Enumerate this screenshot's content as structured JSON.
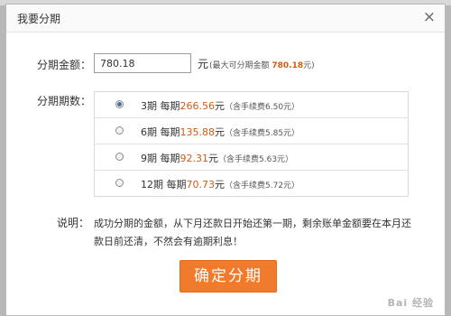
{
  "dialog": {
    "title": "我要分期",
    "close_glyph": "×"
  },
  "amount": {
    "label": "分期金额：",
    "value": "780.18",
    "unit": "元",
    "limit_prefix": "(最大可分期金额",
    "limit_value": "780.18",
    "limit_suffix": "元)"
  },
  "plans": {
    "label": "分期期数：",
    "selected_index": 0,
    "items": [
      {
        "term": "3期 每期",
        "amount": "266.56",
        "unit": "元",
        "fee": "（含手续费6.50元）"
      },
      {
        "term": "6期 每期",
        "amount": "135.88",
        "unit": "元",
        "fee": "（含手续费5.85元）"
      },
      {
        "term": "9期 每期",
        "amount": "92.31",
        "unit": "元",
        "fee": "（含手续费5.63元）"
      },
      {
        "term": "12期 每期",
        "amount": "70.73",
        "unit": "元",
        "fee": "（含手续费5.72元）"
      }
    ]
  },
  "note": {
    "label": "说明：",
    "text": "成功分期的金额，从下月还款日开始还第一期，剩余账单金额要在本月还款日前还清，不然会有逾期利息！"
  },
  "confirm_label": "确定分期",
  "watermark": "Bai 经验",
  "colors": {
    "accent": "#f17b2c",
    "amount_text": "#d25b12"
  }
}
